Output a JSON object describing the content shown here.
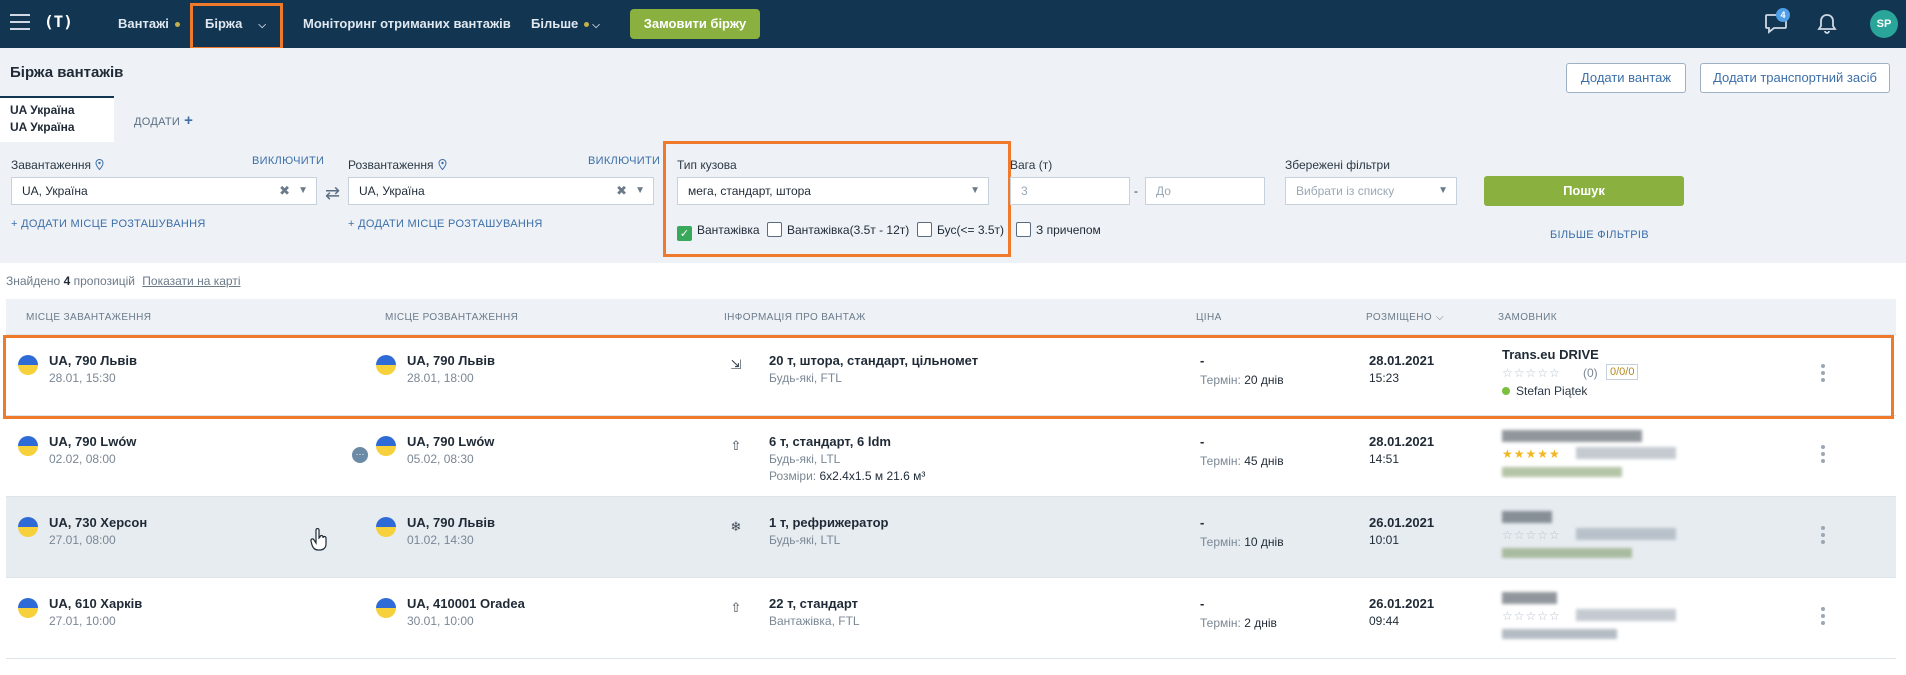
{
  "nav": {
    "logo": "(T)",
    "items": [
      {
        "label": "Вантажі",
        "has_dot": true
      },
      {
        "label": "Біржа",
        "has_chevron": true
      },
      {
        "label": "Моніторинг отриманих вантажів"
      },
      {
        "label": "Більше",
        "has_dot": true,
        "has_chevron": true
      }
    ],
    "order_button": "Замовити біржу",
    "chat_badge": "4",
    "avatar": "SP"
  },
  "header": {
    "title": "Біржа вантажів",
    "add_cargo_button": "Додати вантаж",
    "add_vehicle_button": "Додати транспортний засіб"
  },
  "tabs": {
    "active_line1": "UA Україна",
    "active_line2": "UA Україна",
    "add_label": "ДОДАТИ"
  },
  "filters": {
    "loading": {
      "label": "Завантаження",
      "toggle": "ВИКЛЮЧИТИ",
      "value": "UA,  Україна",
      "add_place": "+ ДОДАТИ МІСЦЕ РОЗТАШУВАННЯ"
    },
    "unloading": {
      "label": "Розвантаження",
      "toggle": "ВИКЛЮЧИТИ",
      "value": "UA,  Україна",
      "add_place": "+ ДОДАТИ МІСЦЕ РОЗТАШУВАННЯ"
    },
    "body_type": {
      "label": "Тип кузова",
      "value": "мега, стандарт, штора"
    },
    "weight": {
      "label": "Вага (т)",
      "from_placeholder": "3",
      "separator": "-",
      "to_placeholder": "До"
    },
    "saved": {
      "label": "Збережені фільтри",
      "placeholder": "Вибрати із списку"
    },
    "vehicle_types": [
      {
        "label": "Вантажівка",
        "checked": true
      },
      {
        "label": "Вантажівка(3.5т - 12т)",
        "checked": false
      },
      {
        "label": "Бус(<= 3.5т)",
        "checked": false
      },
      {
        "label": "З причепом",
        "checked": false
      }
    ],
    "search_button": "Пошук",
    "more_filters": "БІЛЬШЕ ФІЛЬТРІВ"
  },
  "results": {
    "found_prefix": "Знайдено",
    "count": "4",
    "found_suffix": "пропозицій",
    "map_link": "Показати на карті"
  },
  "table": {
    "headers": [
      "МІСЦЕ ЗАВАНТАЖЕННЯ",
      "МІСЦЕ РОЗВАНТАЖЕННЯ",
      "ІНФОРМАЦІЯ ПРО ВАНТАЖ",
      "ЦІНА",
      "РОЗМІЩЕНО",
      "ЗАМОВНИК"
    ],
    "term_label": "Термін:",
    "dims_label": "Розміри:",
    "rows": [
      {
        "from": "UA, 790 Львів",
        "from_date": "28.01, 15:30",
        "to": "UA, 790 Львів",
        "to_date": "28.01, 18:00",
        "cargo": "20 т, штора, стандарт, цільномет",
        "cargo_sub": "Будь-які, FTL",
        "price": "-",
        "term": "20 днів",
        "date": "28.01.2021",
        "time": "15:23",
        "customer": "Trans.eu DRIVE",
        "rating": "(0)",
        "rating_box": "0/0/0",
        "person": "Stefan Piątek"
      },
      {
        "from": "UA, 790 Lwów",
        "from_date": "02.02, 08:00",
        "to": "UA, 790 Lwów",
        "to_date": "05.02, 08:30",
        "cargo": "6 т, стандарт, 6 ldm",
        "cargo_sub": "Будь-які, LTL",
        "dims": "6x2.4x1.5 м 21.6 м³",
        "price": "-",
        "term": "45 днів",
        "date": "28.01.2021",
        "time": "14:51"
      },
      {
        "from": "UA, 730 Херсон",
        "from_date": "27.01, 08:00",
        "to": "UA, 790 Львів",
        "to_date": "01.02, 14:30",
        "cargo": "1 т, рефрижератор",
        "cargo_sub": "Будь-які, LTL",
        "price": "-",
        "term": "10 днів",
        "date": "26.01.2021",
        "time": "10:01"
      },
      {
        "from": "UA, 610 Харків",
        "from_date": "27.01, 10:00",
        "to": "UA, 410001 Oradea",
        "to_date": "30.01, 10:00",
        "cargo": "22 т, стандарт",
        "cargo_sub": "Вантажівка, FTL",
        "price": "-",
        "term": "2 днів",
        "date": "26.01.2021",
        "time": "09:44"
      }
    ]
  }
}
